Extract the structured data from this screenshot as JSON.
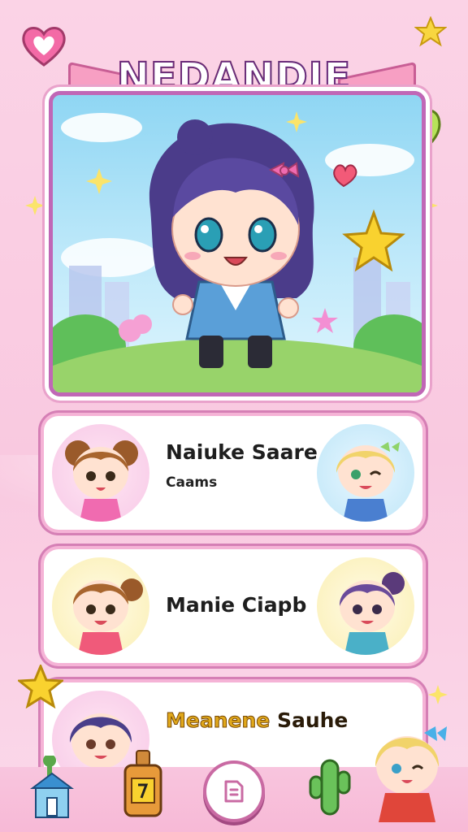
{
  "app": {
    "title": "NEDANDIE"
  },
  "cards": [
    {
      "title": "Naiuke Saare",
      "subtitle": "Caams"
    },
    {
      "title": "Manie Ciapb",
      "subtitle": ""
    },
    {
      "title_highlight": "Meanene",
      "title_rest": "Sauhe",
      "subtitle": ""
    }
  ],
  "colors": {
    "accent": "#c067b6",
    "card_border": "#d57fb5",
    "background": "#fbd3e6"
  },
  "icons": {
    "top_left": "heart-icon",
    "top_right": "star-icon",
    "center_button": "page-icon"
  }
}
